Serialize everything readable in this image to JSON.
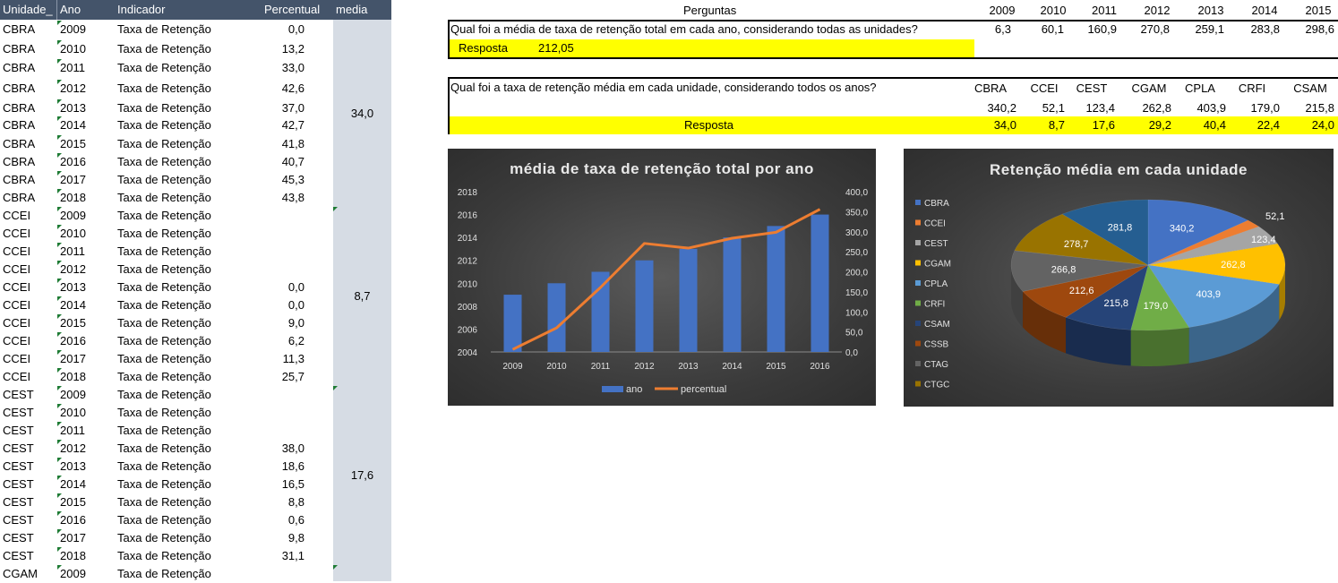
{
  "left_table": {
    "headers": {
      "unidade": "Unidade_",
      "ano": "Ano",
      "indicador": "Indicador",
      "percentual": "Percentual",
      "media": "media"
    },
    "rows": [
      {
        "u": "CBRA",
        "a": "2009",
        "i": "Taxa de Retenção",
        "p": "0,0"
      },
      {
        "u": "CBRA",
        "a": "2010",
        "i": "Taxa de Retenção",
        "p": "13,2"
      },
      {
        "u": "CBRA",
        "a": "2011",
        "i": "Taxa de Retenção",
        "p": "33,0"
      },
      {
        "u": "CBRA",
        "a": "2012",
        "i": "Taxa de Retenção",
        "p": "42,6"
      },
      {
        "u": "CBRA",
        "a": "2013",
        "i": "Taxa de Retenção",
        "p": "37,0"
      },
      {
        "u": "CBRA",
        "a": "2014",
        "i": "Taxa de Retenção",
        "p": "42,7"
      },
      {
        "u": "CBRA",
        "a": "2015",
        "i": "Taxa de Retenção",
        "p": "41,8"
      },
      {
        "u": "CBRA",
        "a": "2016",
        "i": "Taxa de Retenção",
        "p": "40,7"
      },
      {
        "u": "CBRA",
        "a": "2017",
        "i": "Taxa de Retenção",
        "p": "45,3"
      },
      {
        "u": "CBRA",
        "a": "2018",
        "i": "Taxa de Retenção",
        "p": "43,8"
      },
      {
        "u": "CCEI",
        "a": "2009",
        "i": "Taxa de Retenção",
        "p": ""
      },
      {
        "u": "CCEI",
        "a": "2010",
        "i": "Taxa de Retenção",
        "p": ""
      },
      {
        "u": "CCEI",
        "a": "2011",
        "i": "Taxa de Retenção",
        "p": ""
      },
      {
        "u": "CCEI",
        "a": "2012",
        "i": "Taxa de Retenção",
        "p": ""
      },
      {
        "u": "CCEI",
        "a": "2013",
        "i": "Taxa de Retenção",
        "p": "0,0"
      },
      {
        "u": "CCEI",
        "a": "2014",
        "i": "Taxa de Retenção",
        "p": "0,0"
      },
      {
        "u": "CCEI",
        "a": "2015",
        "i": "Taxa de Retenção",
        "p": "9,0"
      },
      {
        "u": "CCEI",
        "a": "2016",
        "i": "Taxa de Retenção",
        "p": "6,2"
      },
      {
        "u": "CCEI",
        "a": "2017",
        "i": "Taxa de Retenção",
        "p": "11,3"
      },
      {
        "u": "CCEI",
        "a": "2018",
        "i": "Taxa de Retenção",
        "p": "25,7"
      },
      {
        "u": "CEST",
        "a": "2009",
        "i": "Taxa de Retenção",
        "p": ""
      },
      {
        "u": "CEST",
        "a": "2010",
        "i": "Taxa de Retenção",
        "p": ""
      },
      {
        "u": "CEST",
        "a": "2011",
        "i": "Taxa de Retenção",
        "p": ""
      },
      {
        "u": "CEST",
        "a": "2012",
        "i": "Taxa de Retenção",
        "p": "38,0"
      },
      {
        "u": "CEST",
        "a": "2013",
        "i": "Taxa de Retenção",
        "p": "18,6"
      },
      {
        "u": "CEST",
        "a": "2014",
        "i": "Taxa de Retenção",
        "p": "16,5"
      },
      {
        "u": "CEST",
        "a": "2015",
        "i": "Taxa de Retenção",
        "p": "8,8"
      },
      {
        "u": "CEST",
        "a": "2016",
        "i": "Taxa de Retenção",
        "p": "0,6"
      },
      {
        "u": "CEST",
        "a": "2017",
        "i": "Taxa de Retenção",
        "p": "9,8"
      },
      {
        "u": "CEST",
        "a": "2018",
        "i": "Taxa de Retenção",
        "p": "31,1"
      },
      {
        "u": "CGAM",
        "a": "2009",
        "i": "Taxa de Retenção",
        "p": ""
      }
    ],
    "medias": [
      "34,0",
      "8,7",
      "17,6"
    ]
  },
  "perguntas": {
    "header": "Perguntas",
    "years": [
      "2009",
      "2010",
      "2011",
      "2012",
      "2013",
      "2014",
      "2015"
    ],
    "q1": "Qual foi a média de taxa de retenção total em cada ano, considerando todas as unidades?",
    "q1_values": [
      "6,3",
      "60,1",
      "160,9",
      "270,8",
      "259,1",
      "283,8",
      "298,6"
    ],
    "q1_answer_label": "Resposta",
    "q1_answer_value": "212,05",
    "q2": "Qual foi a taxa de retenção média em cada unidade, considerando todos os anos?",
    "units": [
      "CBRA",
      "CCEI",
      "CEST",
      "CGAM",
      "CPLA",
      "CRFI",
      "CSAM"
    ],
    "q2_values": [
      "340,2",
      "52,1",
      "123,4",
      "262,8",
      "403,9",
      "179,0",
      "215,8"
    ],
    "q2_answer_label": "Resposta",
    "q2_answers": [
      "34,0",
      "8,7",
      "17,6",
      "29,2",
      "40,4",
      "22,4",
      "24,0"
    ]
  },
  "chart_data": [
    {
      "type": "bar",
      "title": "média de taxa de retenção total por ano",
      "categories": [
        "2009",
        "2010",
        "2011",
        "2012",
        "2013",
        "2014",
        "2015",
        "2016"
      ],
      "ylim_left": [
        2004,
        2018
      ],
      "ylim_right": [
        0,
        400
      ],
      "left_ticks": [
        "2018",
        "2016",
        "2014",
        "2012",
        "2010",
        "2008",
        "2006",
        "2004"
      ],
      "right_ticks": [
        "400,0",
        "350,0",
        "300,0",
        "250,0",
        "200,0",
        "150,0",
        "100,0",
        "50,0",
        "0,0"
      ],
      "series": [
        {
          "name": "ano",
          "type": "bar",
          "axis": "left",
          "values": [
            2009,
            2010,
            2011,
            2012,
            2013,
            2014,
            2015,
            2016
          ],
          "color": "#4472c4"
        },
        {
          "name": "percentual",
          "type": "line",
          "axis": "right",
          "values": [
            6.3,
            60.1,
            160.9,
            270.8,
            259.1,
            283.8,
            298.6,
            356
          ],
          "color": "#ed7d31"
        }
      ]
    },
    {
      "type": "pie",
      "title": "Retenção média em cada unidade",
      "legend": [
        "CBRA",
        "CCEI",
        "CEST",
        "CGAM",
        "CPLA",
        "CRFI",
        "CSAM",
        "CSSB",
        "CTAG",
        "CTGC"
      ],
      "values": [
        340.2,
        52.1,
        123.4,
        262.8,
        403.9,
        179.0,
        215.8,
        212.6,
        266.8,
        278.7,
        281.8
      ],
      "labels": [
        "340,2",
        "52,1",
        "123,4",
        "262,8",
        "403,9",
        "179,0",
        "215,8",
        "212,6",
        "266,8",
        "278,7",
        "281,8"
      ],
      "colors": [
        "#4472c4",
        "#ed7d31",
        "#a5a5a5",
        "#ffc000",
        "#5b9bd5",
        "#70ad47",
        "#264478",
        "#9e480e",
        "#636363",
        "#997300",
        "#255e91"
      ],
      "legend_position": "left"
    }
  ]
}
